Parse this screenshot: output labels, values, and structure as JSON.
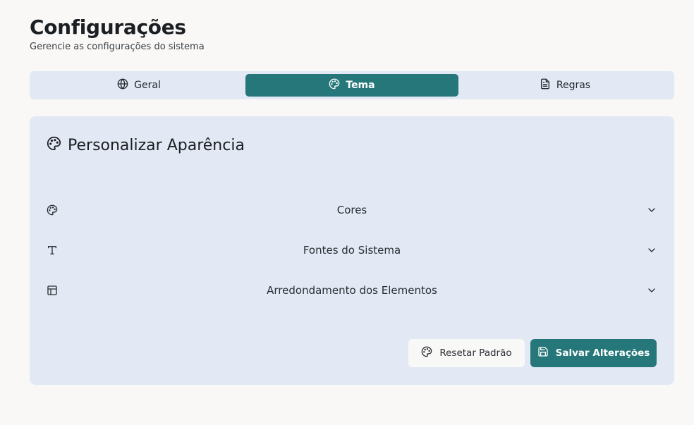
{
  "header": {
    "title": "Configurações",
    "subtitle": "Gerencie as configurações do sistema"
  },
  "tabs": [
    {
      "label": "Geral",
      "icon": "globe-icon",
      "active": false
    },
    {
      "label": "Tema",
      "icon": "palette-icon",
      "active": true
    },
    {
      "label": "Regras",
      "icon": "document-icon",
      "active": false
    }
  ],
  "card": {
    "title": "Personalizar Aparência",
    "icon": "palette-icon",
    "sections": [
      {
        "label": "Cores",
        "icon": "palette-icon"
      },
      {
        "label": "Fontes do Sistema",
        "icon": "type-icon"
      },
      {
        "label": "Arredondamento dos Elementos",
        "icon": "layout-icon"
      }
    ]
  },
  "actions": {
    "reset_label": "Resetar Padrão",
    "save_label": "Salvar Alterações"
  },
  "colors": {
    "accent": "#26777a",
    "panel": "#e2e9f4",
    "background": "#f9f8f6"
  }
}
